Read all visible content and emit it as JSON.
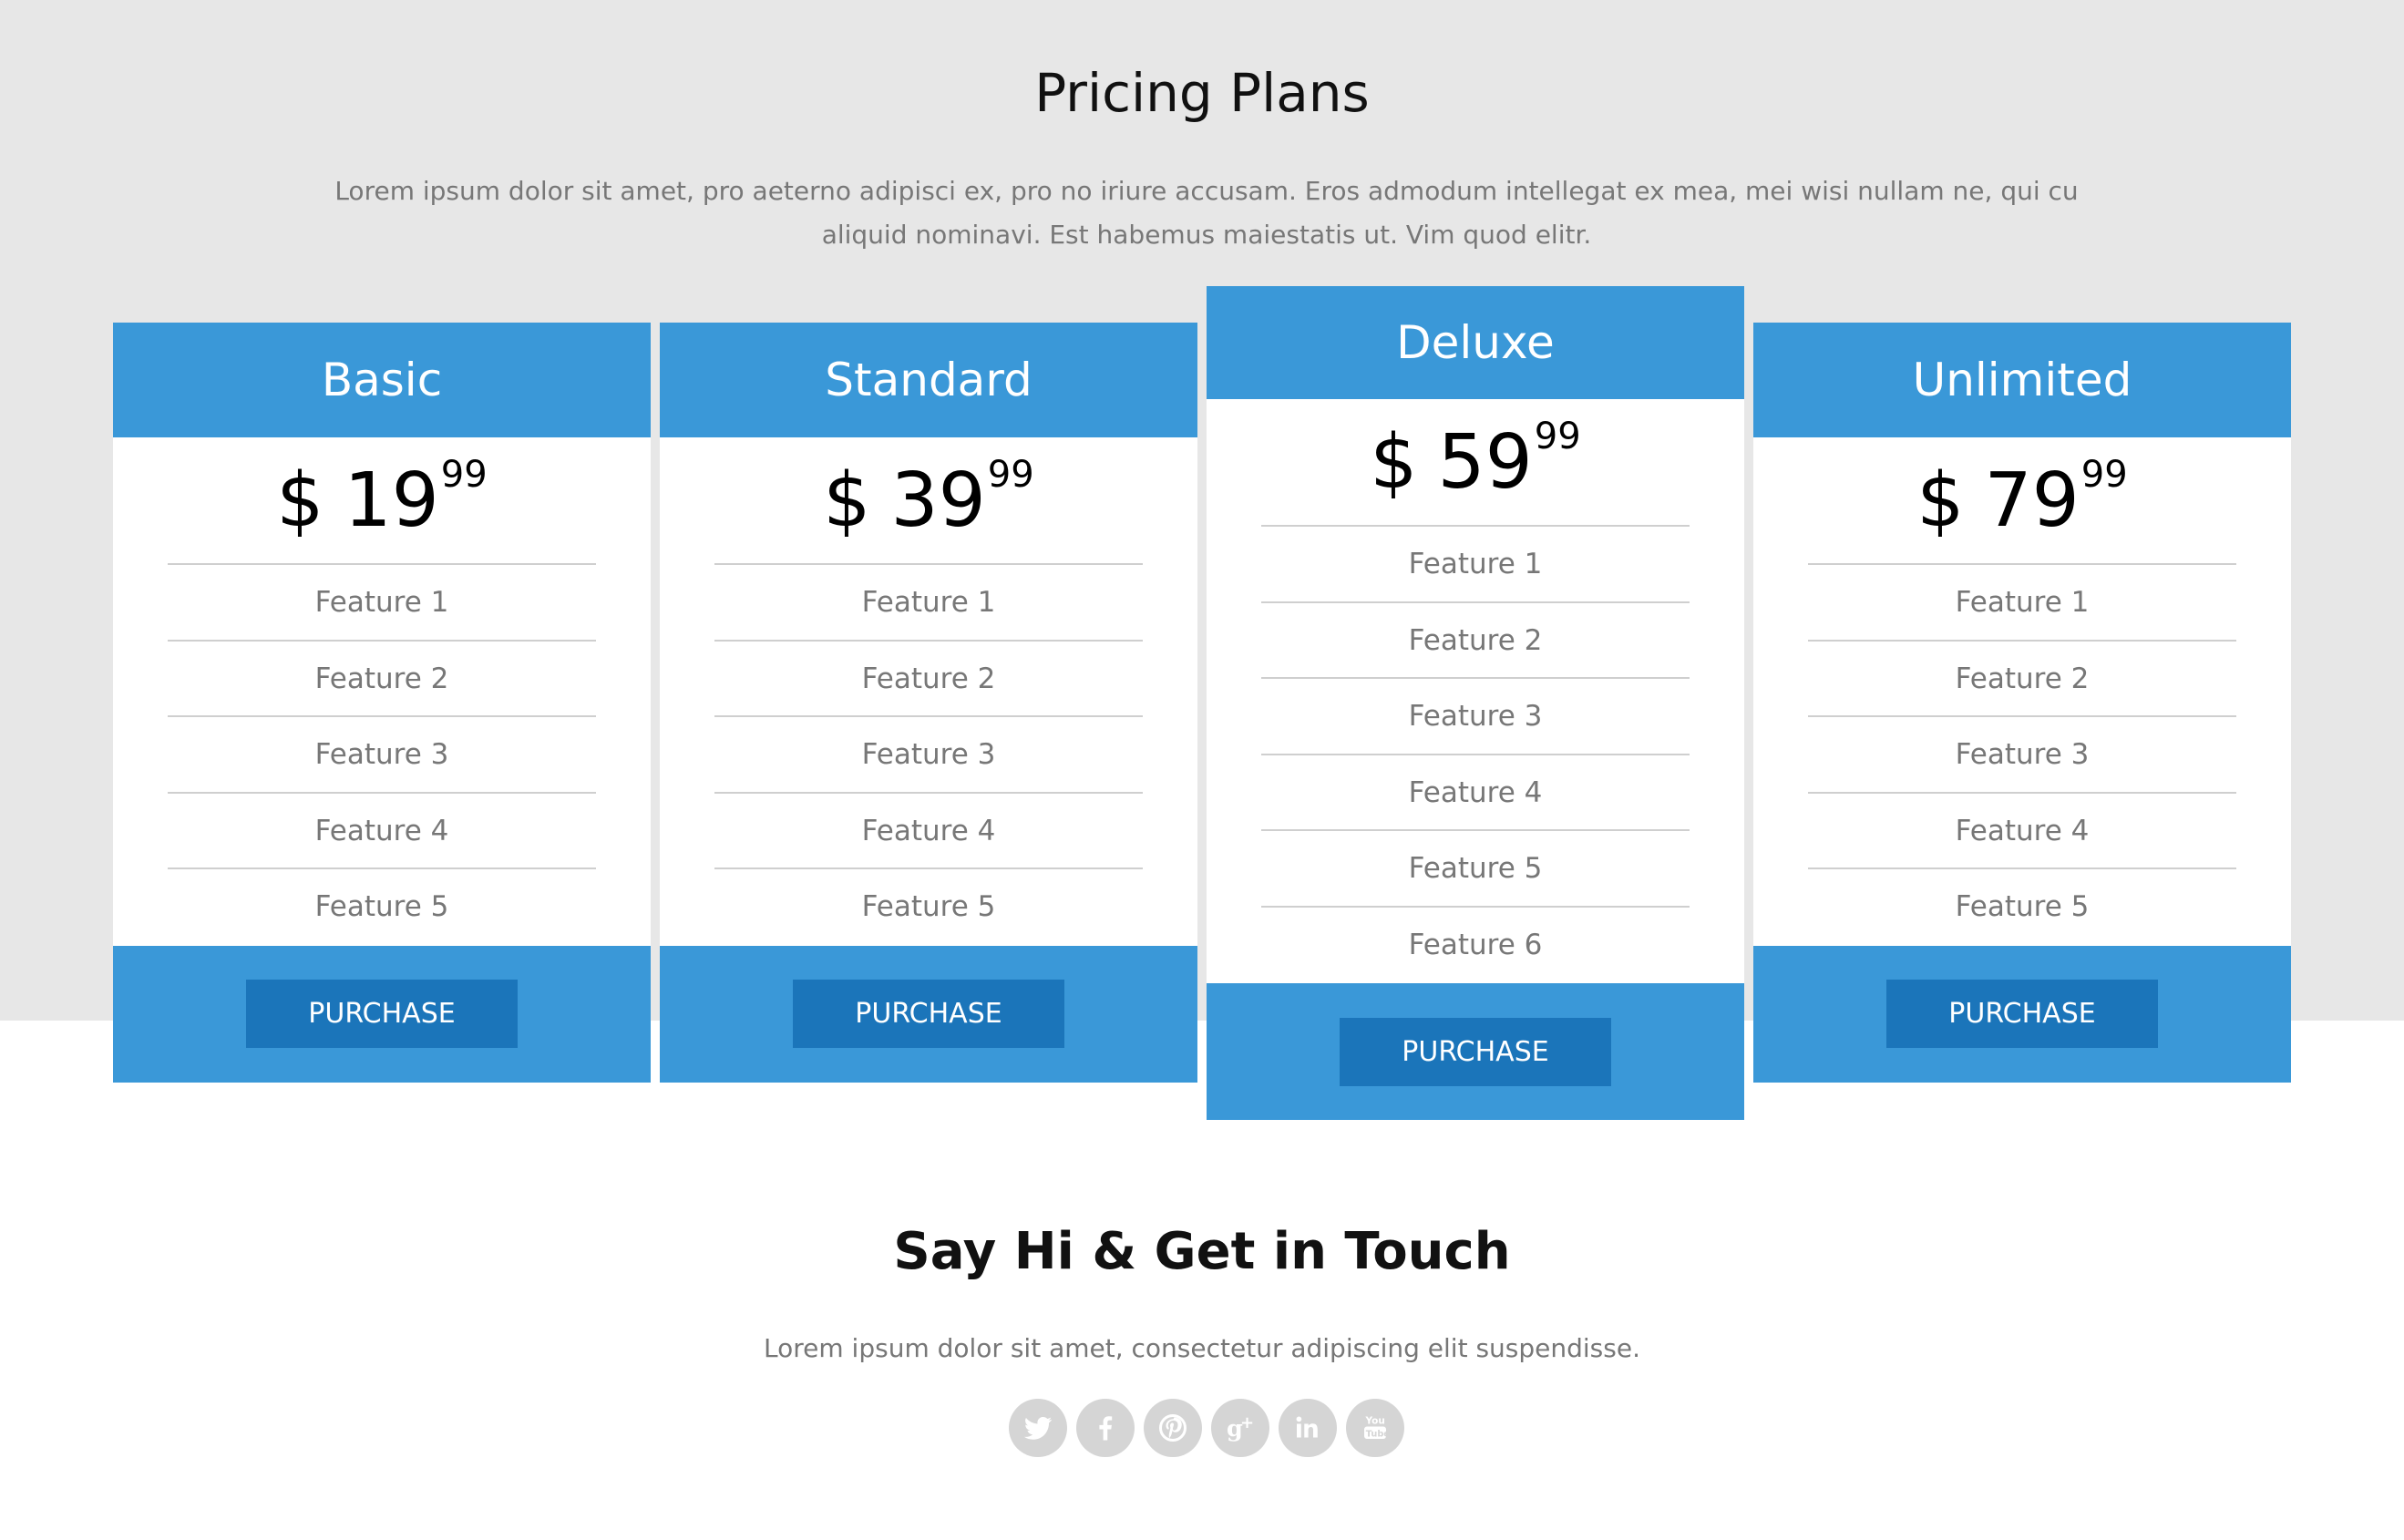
{
  "pricing": {
    "title": "Pricing Plans",
    "subtitle": "Lorem ipsum dolor sit amet, pro aeterno adipisci ex, pro no iriure accusam. Eros admodum intellegat ex mea, mei wisi nullam ne, qui cu aliquid nominavi. Est habemus maiestatis ut. Vim quod elitr.",
    "plans": [
      {
        "name": "Basic",
        "currency": "$",
        "price": "19",
        "cents": "99",
        "features": [
          "Feature 1",
          "Feature 2",
          "Feature 3",
          "Feature 4",
          "Feature 5"
        ],
        "button": "PURCHASE"
      },
      {
        "name": "Standard",
        "currency": "$",
        "price": "39",
        "cents": "99",
        "features": [
          "Feature 1",
          "Feature 2",
          "Feature 3",
          "Feature 4",
          "Feature 5"
        ],
        "button": "PURCHASE"
      },
      {
        "name": "Deluxe",
        "currency": "$",
        "price": "59",
        "cents": "99",
        "features": [
          "Feature 1",
          "Feature 2",
          "Feature 3",
          "Feature 4",
          "Feature 5",
          "Feature 6"
        ],
        "button": "PURCHASE",
        "featured": true
      },
      {
        "name": "Unlimited",
        "currency": "$",
        "price": "79",
        "cents": "99",
        "features": [
          "Feature 1",
          "Feature 2",
          "Feature 3",
          "Feature 4",
          "Feature 5"
        ],
        "button": "PURCHASE"
      }
    ]
  },
  "contact": {
    "title": "Say Hi & Get in Touch",
    "subtitle": "Lorem ipsum dolor sit amet, consectetur adipiscing elit suspendisse."
  },
  "social_icons": [
    "twitter-icon",
    "facebook-icon",
    "pinterest-icon",
    "google-plus-icon",
    "linkedin-icon",
    "youtube-icon"
  ],
  "colors": {
    "accent": "#3a98d8",
    "button": "#1b75ba",
    "band": "#e7e7e7",
    "muted_text": "#777777"
  }
}
